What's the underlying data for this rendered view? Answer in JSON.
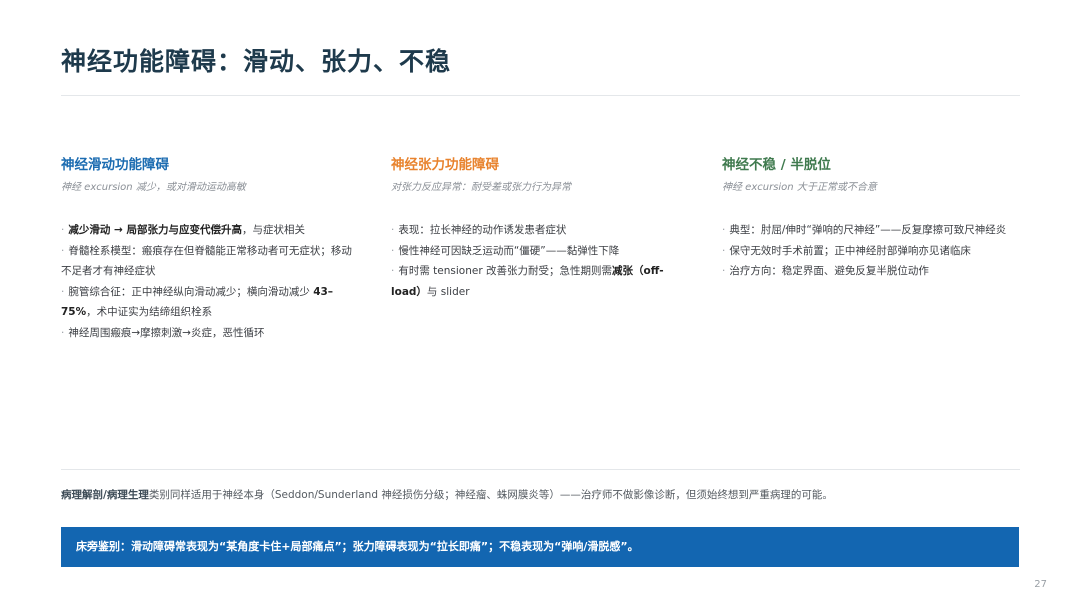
{
  "title": "神经功能障碍：滑动、张力、不稳",
  "colors": {
    "col1": "#1c6cb1",
    "col2": "#e8832e",
    "col3": "#3f7a4e",
    "banner": "#1366b1"
  },
  "columns": [
    {
      "heading": "神经滑动功能障碍",
      "subtitle": "神经 excursion 减少，或对滑动运动高敏",
      "items": [
        {
          "bold": "减少滑动 → 局部张力与应变代偿升高",
          "text": "，与症状相关"
        },
        {
          "text": "脊髓栓系模型：瘢痕存在但脊髓能正常移动者可无症状；移动不足者才有神经症状"
        },
        {
          "text": "腕管综合征：正中神经纵向滑动减少；横向滑动减少 ",
          "bold2": "43–75%",
          "text2": "，术中证实为结缔组织栓系"
        },
        {
          "text": "神经周围瘢痕→摩擦刺激→炎症，恶性循环"
        }
      ]
    },
    {
      "heading": "神经张力功能障碍",
      "subtitle": "对张力反应异常：耐受差或张力行为异常",
      "items": [
        {
          "text": "表现：拉长神经的动作诱发患者症状"
        },
        {
          "text": "慢性神经可因缺乏运动而“僵硬”——黏弹性下降"
        },
        {
          "text": "有时需 tensioner 改善张力耐受；急性期则需",
          "bold2": "减张（off-load）",
          "text2": "与 slider"
        }
      ]
    },
    {
      "heading": "神经不稳 / 半脱位",
      "subtitle": "神经 excursion 大于正常或不合意",
      "items": [
        {
          "text": "典型：肘屈/伸时“弹响的尺神经”——反复摩擦可致尺神经炎"
        },
        {
          "text": "保守无效时手术前置；正中神经肘部弹响亦见诸临床"
        },
        {
          "text": "治疗方向：稳定界面、避免反复半脱位动作"
        }
      ]
    }
  ],
  "note": {
    "bold": "病理解剖/病理生理",
    "text": "类别同样适用于神经本身（Seddon/Sunderland 神经损伤分级；神经瘤、蛛网膜炎等）——治疗师不做影像诊断，但须始终想到严重病理的可能。"
  },
  "banner": "床旁鉴别：滑动障碍常表现为“某角度卡住+局部痛点”；张力障碍表现为“拉长即痛”；不稳表现为“弹响/滑脱感”。",
  "page_number": "27"
}
